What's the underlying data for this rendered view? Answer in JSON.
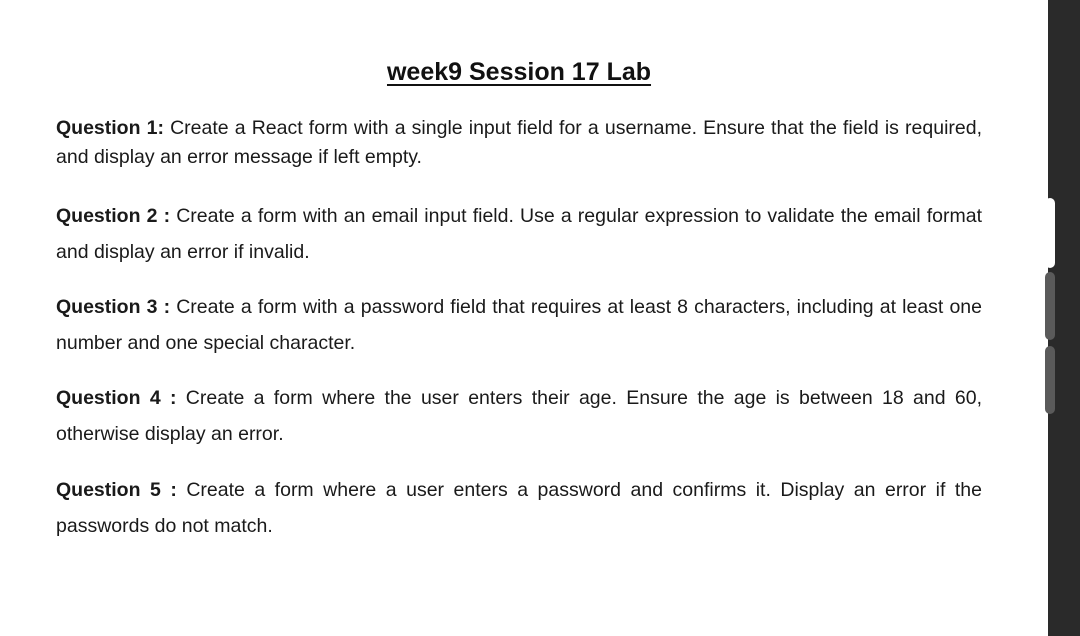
{
  "document": {
    "title": "week9 Session 17 Lab",
    "questions": [
      {
        "label": "Question 1:",
        "text": " Create a React form with a single input field for a username. Ensure that the field is required, and display an error message if left empty."
      },
      {
        "label": "Question 2 :",
        "text": " Create a form with an email input field. Use a regular expression to validate the email format and display an error if invalid."
      },
      {
        "label": "Question 3 :",
        "text": " Create a form with a password field that requires at least 8 characters, including at least one number and one special character."
      },
      {
        "label": "Question 4 :",
        "text": " Create a form where the user enters their age. Ensure the age is between 18 and 60, otherwise display an error."
      },
      {
        "label": "Question 5 :",
        "text": " Create a form where a user enters a password and confirms it. Display an error if the passwords do not match."
      }
    ]
  }
}
